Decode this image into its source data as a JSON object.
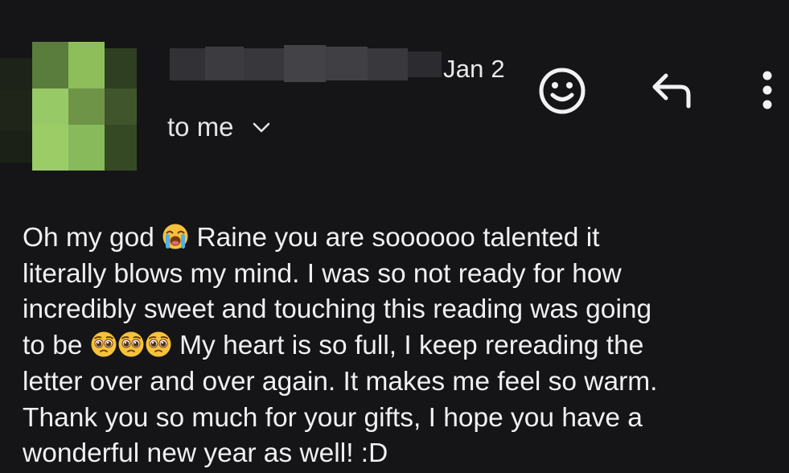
{
  "header": {
    "date": "Jan 2",
    "recipient": "to me"
  },
  "icons": {
    "avatar": "avatar-blurred",
    "sender_name": "sender-name-blurred",
    "recipient_toggle": "chevron-down-icon",
    "react": "smiley-icon",
    "reply": "reply-arrow-icon",
    "more": "more-vertical-icon"
  },
  "message": {
    "line1_a": "Oh my god",
    "line1_b": "Raine you are soooooo talented it",
    "line2": "literally blows my mind. I was so not ready for how",
    "line3": "incredibly sweet and touching this reading was going",
    "line4_a": "to be",
    "line4_b": "My heart is so full, I keep rereading the",
    "line5": "letter over and over again. It makes me feel so warm.",
    "line6": "Thank you so much for your gifts, I hope you have a",
    "line7": "wonderful new year as well! :D",
    "emojis": [
      "loudly-crying-face",
      "pleading-face",
      "pleading-face",
      "pleading-face"
    ]
  },
  "colors": {
    "background": "#151517",
    "text": "#f0f0f2",
    "avatar_green": "#8dbe5a"
  }
}
